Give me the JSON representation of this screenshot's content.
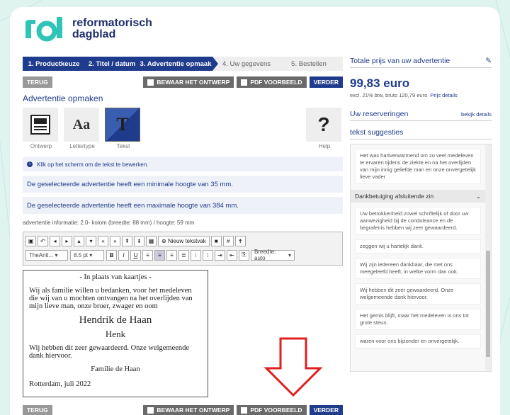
{
  "brand": {
    "line1": "reformatorisch",
    "line2": "dagblad"
  },
  "steps": [
    {
      "label": "1. Productkeuze",
      "state": "active"
    },
    {
      "label": "2. Titel / datum",
      "state": "active"
    },
    {
      "label": "3. Advertentie opmaak",
      "state": "active"
    },
    {
      "label": "4. Uw gegevens",
      "state": "inactive"
    },
    {
      "label": "5. Bestellen",
      "state": "inactive"
    }
  ],
  "actions": {
    "back": "TERUG",
    "save": "BEWAAR HET ONTWERP",
    "preview": "PDF VOORBEELD",
    "next": "VERDER"
  },
  "editor": {
    "title": "Advertentie opmaken",
    "tools": {
      "design": "Ontwerp",
      "font": "Lettertype",
      "text": "Tekst",
      "help": "Help"
    },
    "tool_glyphs": {
      "font": "Aa",
      "text": "T",
      "help": "?"
    },
    "info": "Klik op het scherm om de tekst te bewerken.",
    "min_height": "De geselecteerde advertentie heeft een minimale hoogte van 35 mm.",
    "max_height": "De geselecteerde advertentie heeft een maximale hoogte van 384 mm.",
    "meta": "advertentie informatie: 2.0- kolom (breedte: 88 mm) / hoogte: 59 mm",
    "toolbar": {
      "new_textbox": "Nieuw tekstvak",
      "font_select": "TheAnti...",
      "size_select": "8.5 pt",
      "width_select": "Breedte: auto"
    }
  },
  "ad": {
    "header": "- In plaats van kaartjes -",
    "body": "Wij als familie willen u bedanken, voor het medeleven die wij van u mochten ontvangen na het overlijden van mijn lieve man, onze broer, zwager en oom",
    "name": "Hendrik de Haan",
    "nickname": "Henk",
    "thanks": "Wij hebben dit zeer gewaardeerd. Onze welgemeende dank hiervoor.",
    "family": "Familie de Haan",
    "place_date": "Rotterdam, juli 2022"
  },
  "sidebar": {
    "price_title": "Totale prijs van uw advertentie",
    "price": "99,83 euro",
    "price_note": "excl. 21% btw, bruto 120,79 euro",
    "price_details": "Prijs details",
    "reservations": "Uw reserveringen",
    "reservations_link": "bekijk details",
    "suggestions_title": "tekst suggesties",
    "suggestion_first": "Het was hartverwarmend om zo veel medeleven te ervaren tijdens de ziekte en na het overlijden van mijn innig geliefde man en onze onvergetelijk lieve vader",
    "category": "Dankbetuiging afsluitende zin",
    "suggestions": [
      "Uw betrokkenheid zowel schriftelijk of door uw aanwezigheid bij de condoleance en de begrafenis hebben wij zeer gewaardeerd.",
      "zeggen wij u hartelijk dank.",
      "Wij zijn iedereen dankbaar, die met ons meegeleefd heeft, in welke vorm dan ook.",
      "Wij hebben dit zeer gewaardeerd. Onze welgemeende dank hiervoor.",
      "Het gemis blijft, maar het medeleven is ons tot grote steun.",
      "waren voor ons bijzonder en onvergetelijk."
    ]
  },
  "colors": {
    "brand": "#1f3b8c",
    "accent_arrow": "#e02020"
  }
}
